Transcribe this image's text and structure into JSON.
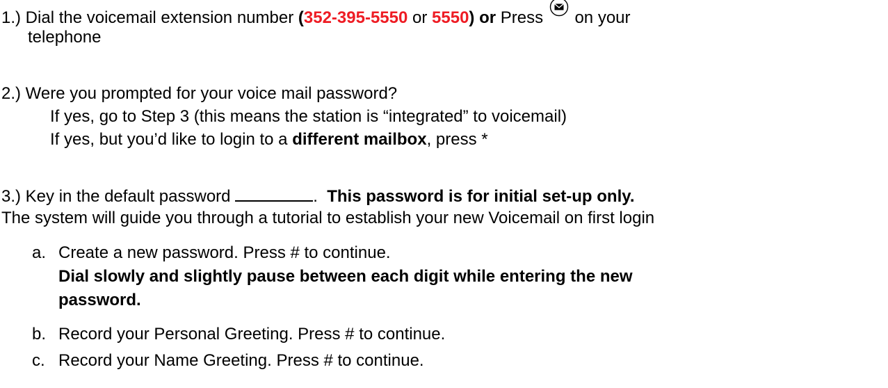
{
  "step1": {
    "prefix": "1.) Dial the voicemail extension number ",
    "open_paren": "(",
    "number_full": "352-395-5550",
    "or_text": " or ",
    "number_short": "5550",
    "close_or": ") or",
    "press_text": " Press ",
    "icon": "envelope-icon",
    "suffix": " on your",
    "line2": "telephone"
  },
  "step2": {
    "line1": "2.) Were you prompted for your voice mail password?",
    "line2": "If yes, go to Step 3 (this means the station is “integrated” to voicemail)",
    "line3_prefix": "If yes, but you’d like to login to a ",
    "line3_bold": "different mailbox",
    "line3_suffix": ", press *"
  },
  "step3": {
    "prefix": "3.) Key in the default password ",
    "after_blank": ".  ",
    "bold": "This password is for initial set-up only.",
    "line2": "The system will guide you through a tutorial to establish your new Voicemail on first login",
    "items": [
      {
        "letter": "a.",
        "text": "Create a new password. Press # to continue."
      },
      {
        "letter": "b.",
        "text": "Record your Personal Greeting. Press # to continue."
      },
      {
        "letter": "c.",
        "text": "Record your Name Greeting. Press # to continue."
      }
    ],
    "note_line1": "Dial slowly and slightly pause between each digit while entering the new",
    "note_line2": "password."
  },
  "colors": {
    "accent_red": "#ee1c24",
    "text": "#000000"
  }
}
